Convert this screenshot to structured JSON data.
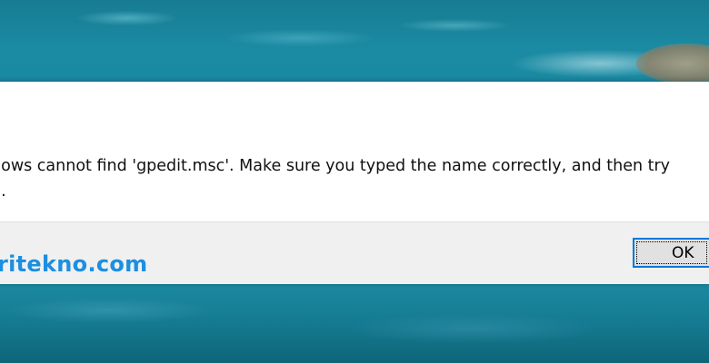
{
  "dialog": {
    "message_line1": "dows cannot find 'gpedit.msc'. Make sure you typed the name correctly, and then try",
    "message_line2": "n.",
    "ok_label": "OK"
  },
  "watermark": {
    "text": "ritekno.com"
  },
  "colors": {
    "accent": "#0078d7",
    "watermark": "#1c8fe0",
    "footer_bg": "#f0f0f0",
    "desktop_water": "#1a86a0"
  }
}
